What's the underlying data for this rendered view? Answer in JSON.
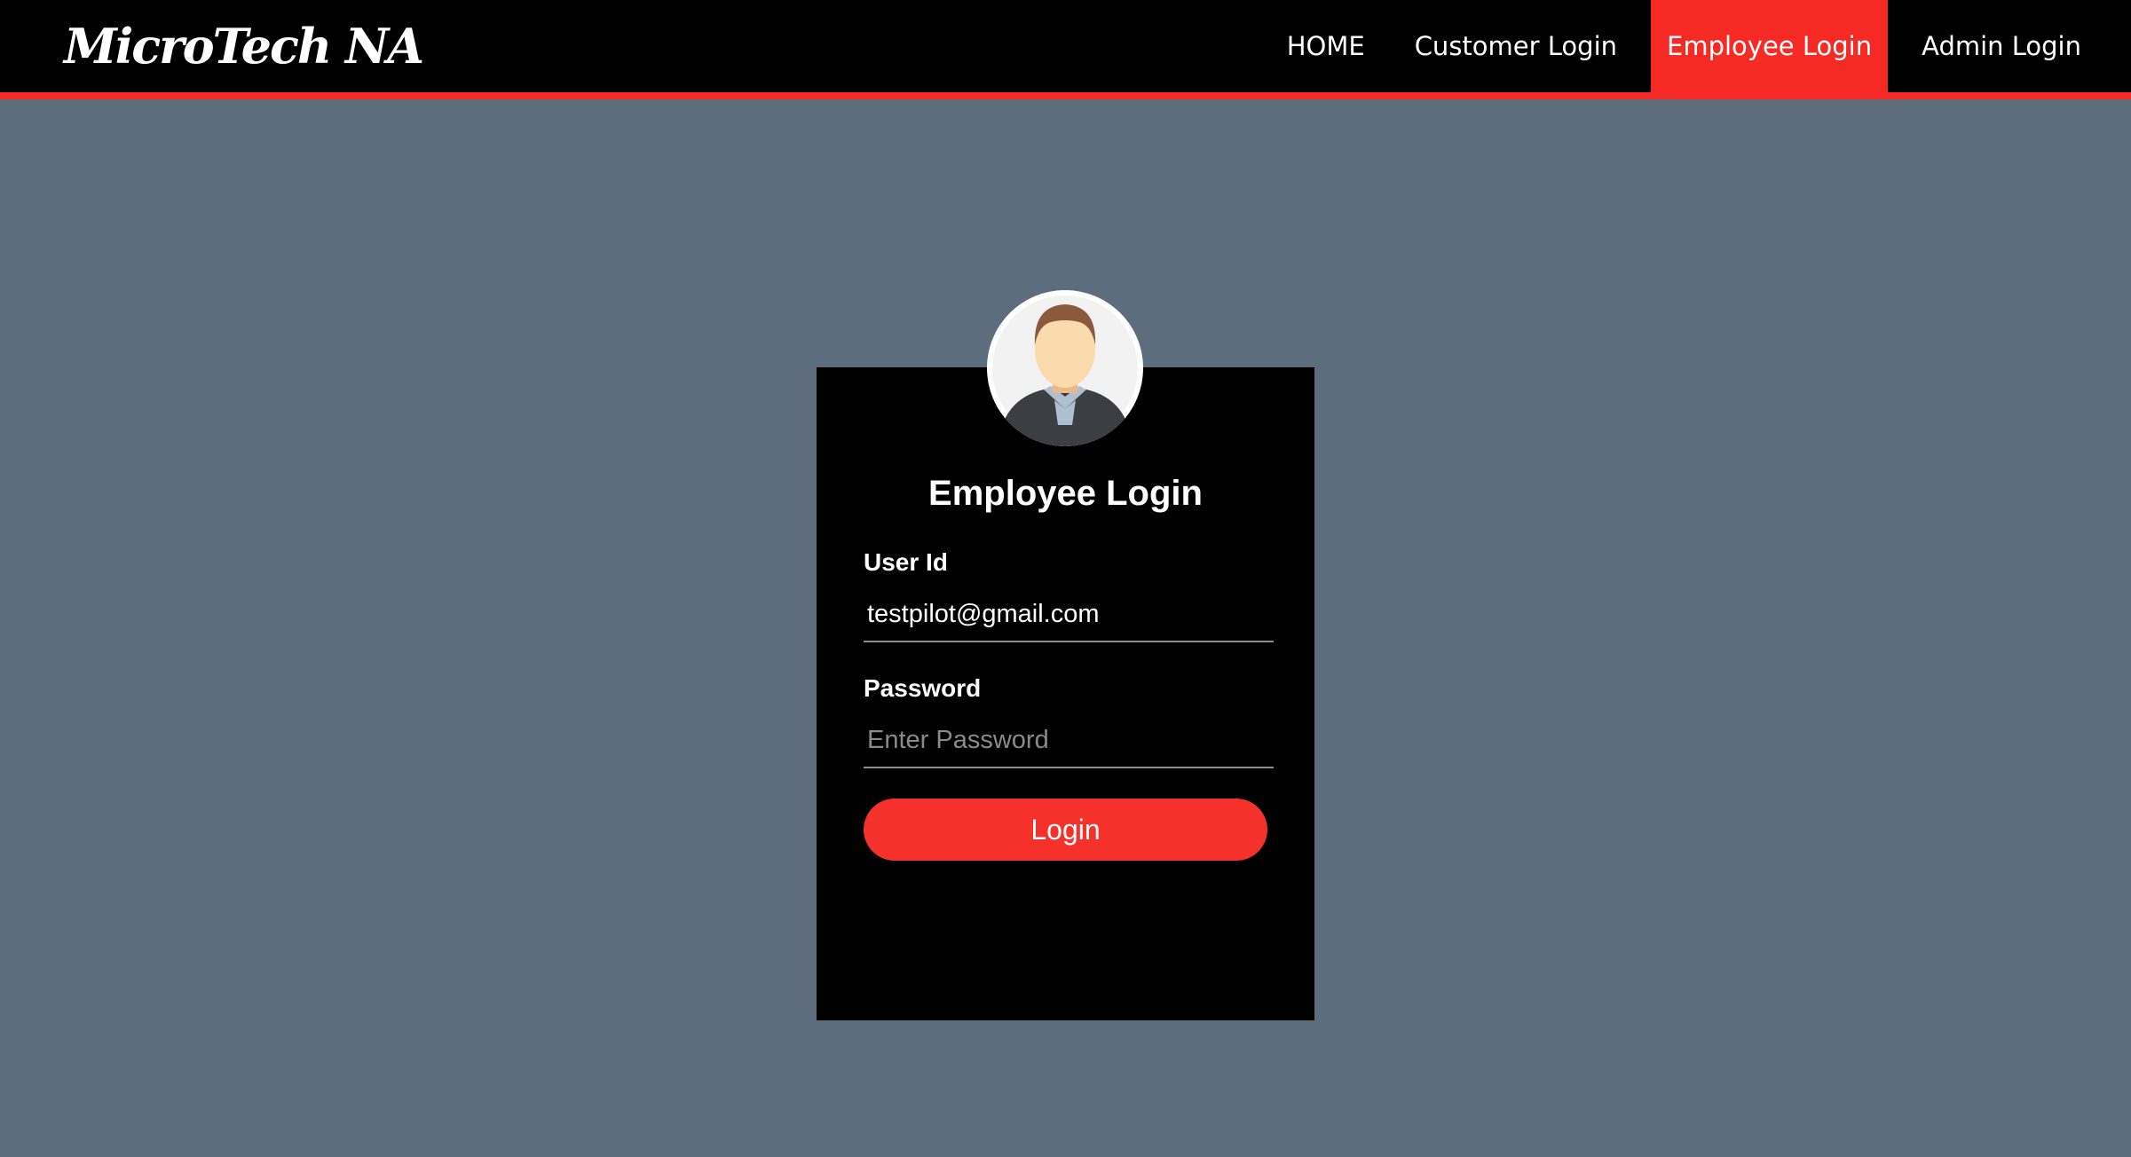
{
  "header": {
    "brand": "MicroTech NA",
    "nav": [
      {
        "label": "HOME",
        "active": false
      },
      {
        "label": "Customer Login",
        "active": false
      },
      {
        "label": "Employee Login",
        "active": true
      },
      {
        "label": "Admin Login",
        "active": false
      }
    ]
  },
  "login_card": {
    "avatar_icon": "user-avatar-icon",
    "title": "Employee Login",
    "user_id_label": "User Id",
    "user_id_value": "testpilot@gmail.com",
    "password_label": "Password",
    "password_placeholder": "Enter Password",
    "login_button": "Login"
  },
  "colors": {
    "accent": "#f52a24",
    "background": "#5e6d7e",
    "card": "#000000"
  }
}
